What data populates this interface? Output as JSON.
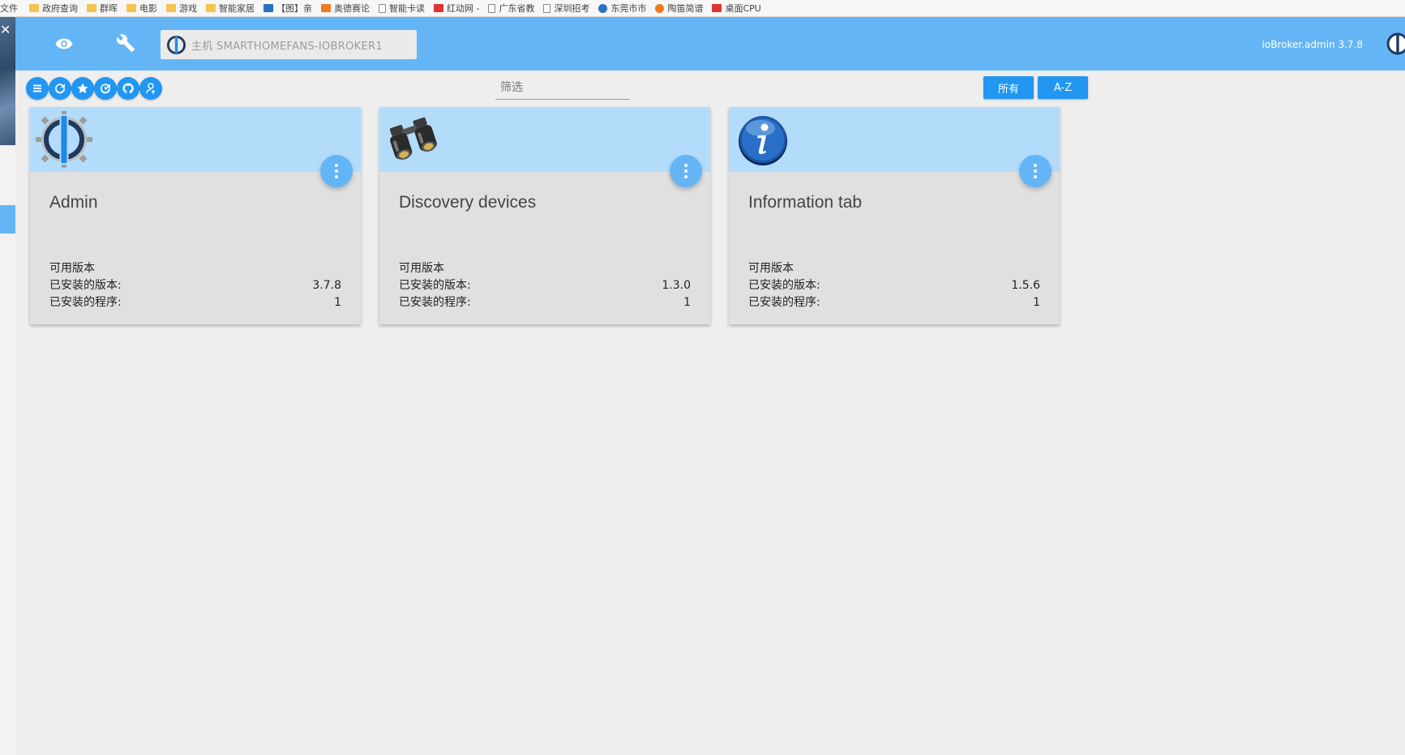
{
  "bookmarks": [
    {
      "label": "文件",
      "icon": "none"
    },
    {
      "label": "政府查询",
      "icon": "folder"
    },
    {
      "label": "群晖",
      "icon": "folder"
    },
    {
      "label": "电影",
      "icon": "folder"
    },
    {
      "label": "游戏",
      "icon": "folder"
    },
    {
      "label": "智能家居",
      "icon": "folder"
    },
    {
      "label": "【图】亲",
      "icon": "blue"
    },
    {
      "label": "奥德赛论",
      "icon": "orange"
    },
    {
      "label": "智能卡读",
      "icon": "doc"
    },
    {
      "label": "红动网 -",
      "icon": "red"
    },
    {
      "label": "广东省教",
      "icon": "doc"
    },
    {
      "label": "深圳招考",
      "icon": "doc"
    },
    {
      "label": "东莞市市",
      "icon": "blue-round"
    },
    {
      "label": "陶笛简谱",
      "icon": "orange-round"
    },
    {
      "label": "桌面CPU",
      "icon": "red"
    }
  ],
  "appbar": {
    "host_label": "主机 SMARTHOMEFANS-IOBROKER1",
    "title": "ioBroker.admin 3.7.8"
  },
  "toolbar": {
    "buttons": [
      "list-icon",
      "refresh-icon",
      "star-icon",
      "update-icon",
      "github-icon",
      "upload-icon"
    ],
    "filter_placeholder": "筛选",
    "filter_value": "",
    "all_label": "所有",
    "sort_label": "A-Z"
  },
  "colors": {
    "appbar": "#64b5f6",
    "accent": "#2196f3",
    "card_header": "#b3dcfb",
    "card_body": "#e0e0e0",
    "background": "#eeeeee"
  },
  "labels": {
    "available": "可用版本",
    "installed_version": "已安装的版本:",
    "installed_instances": "已安装的程序:"
  },
  "cards": [
    {
      "title": "Admin",
      "icon": "iobroker-logo-icon",
      "available": "",
      "installed_version": "3.7.8",
      "instances": "1"
    },
    {
      "title": "Discovery devices",
      "icon": "binoculars-icon",
      "available": "",
      "installed_version": "1.3.0",
      "instances": "1"
    },
    {
      "title": "Information tab",
      "icon": "info-icon",
      "available": "",
      "installed_version": "1.5.6",
      "instances": "1"
    }
  ]
}
